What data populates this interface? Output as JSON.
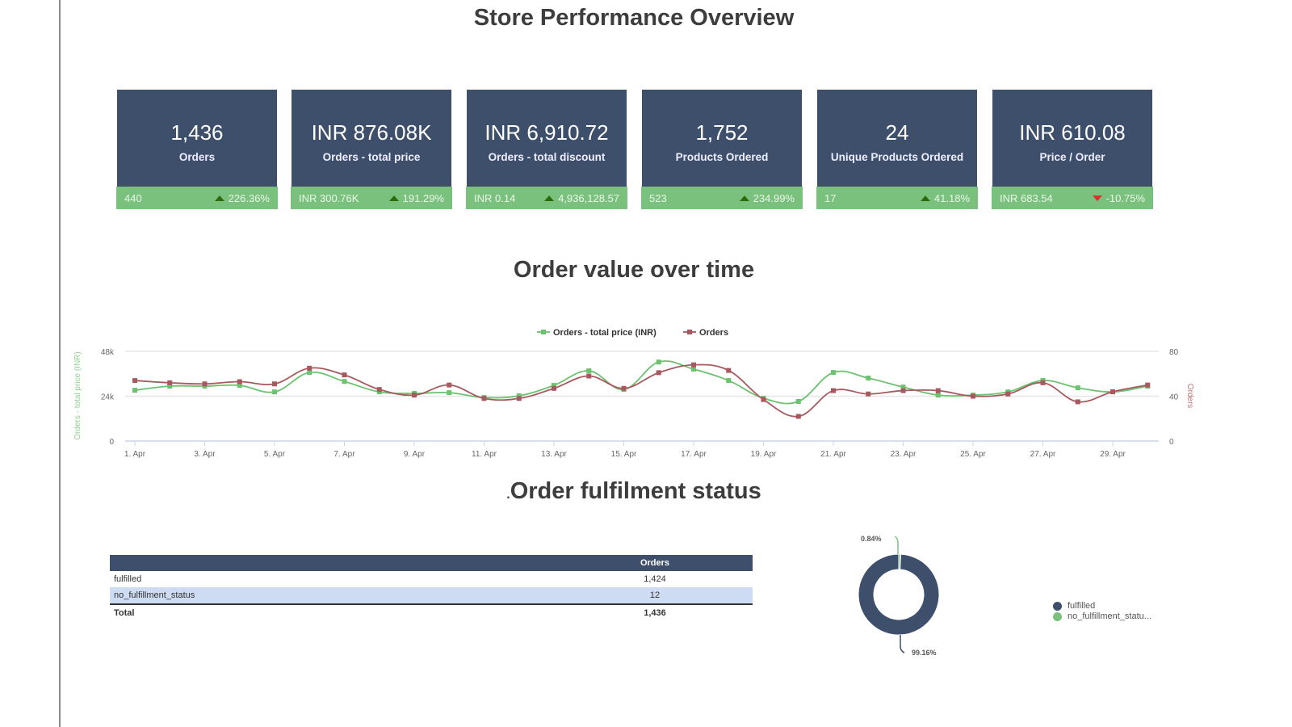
{
  "page": {
    "title": "Store Performance Overview",
    "chart_section_title": "Order value over time",
    "fulfilment_section_title": "Order fulfilment status",
    "fulfilment_title_prefix": "."
  },
  "kpis": [
    {
      "value": "1,436",
      "label": "Orders",
      "previous": "440",
      "change": "226.36%",
      "direction": "up"
    },
    {
      "value": "INR 876.08K",
      "label": "Orders - total price",
      "previous": "INR 300.76K",
      "change": "191.29%",
      "direction": "up"
    },
    {
      "value": "INR 6,910.72",
      "label": "Orders - total discount",
      "previous": "INR 0.14",
      "change": "4,936,128.57",
      "direction": "up"
    },
    {
      "value": "1,752",
      "label": "Products Ordered",
      "previous": "523",
      "change": "234.99%",
      "direction": "up"
    },
    {
      "value": "24",
      "label": "Unique Products Ordered",
      "previous": "17",
      "change": "41.18%",
      "direction": "up"
    },
    {
      "value": "INR 610.08",
      "label": "Price / Order",
      "previous": "INR 683.54",
      "change": "-10.75%",
      "direction": "down"
    }
  ],
  "colors": {
    "kpi_bg": "#3d4f6b",
    "kpi_footer": "#7bc17e",
    "up": "#2d6b0f",
    "down": "#d9302e",
    "series_price": "#6cc26f",
    "series_orders": "#a7595f",
    "fulfilled": "#3d4f6b",
    "no_fulfillment": "#7bc17e"
  },
  "chart_data": [
    {
      "type": "line",
      "title": "Order value over time",
      "x": [
        "1. Apr",
        "2. Apr",
        "3. Apr",
        "4. Apr",
        "5. Apr",
        "6. Apr",
        "7. Apr",
        "8. Apr",
        "9. Apr",
        "10. Apr",
        "11. Apr",
        "12. Apr",
        "13. Apr",
        "14. Apr",
        "15. Apr",
        "16. Apr",
        "17. Apr",
        "18. Apr",
        "19. Apr",
        "20. Apr",
        "21. Apr",
        "22. Apr",
        "23. Apr",
        "24. Apr",
        "25. Apr",
        "26. Apr",
        "27. Apr",
        "28. Apr",
        "29. Apr",
        "30. Apr"
      ],
      "x_tick_labels": [
        "1. Apr",
        "3. Apr",
        "5. Apr",
        "7. Apr",
        "9. Apr",
        "11. Apr",
        "13. Apr",
        "15. Apr",
        "17. Apr",
        "19. Apr",
        "21. Apr",
        "23. Apr",
        "25. Apr",
        "27. Apr",
        "29. Apr"
      ],
      "series": [
        {
          "name": "Orders - total price (INR)",
          "axis": "left",
          "values": [
            27200,
            29400,
            29400,
            29800,
            26300,
            36700,
            31900,
            26300,
            25500,
            25900,
            23300,
            24200,
            29800,
            37600,
            27600,
            42300,
            38500,
            32400,
            22900,
            21200,
            36700,
            33700,
            28900,
            24600,
            24600,
            26300,
            32400,
            28500,
            26300,
            29400
          ]
        },
        {
          "name": "Orders",
          "axis": "right",
          "values": [
            54,
            52,
            51,
            53,
            51,
            65,
            59,
            46,
            41,
            50,
            38,
            38,
            47,
            58,
            47,
            61,
            68,
            63,
            37,
            22,
            45,
            42,
            45,
            45,
            40,
            42,
            52,
            35,
            44,
            50
          ]
        }
      ],
      "left_axis": {
        "label": "Orders - total price (INR)",
        "ticks": [
          "0",
          "24k",
          "48k"
        ],
        "range": [
          0,
          48000
        ]
      },
      "right_axis": {
        "label": "Orders",
        "ticks": [
          "0",
          "40",
          "80"
        ],
        "range": [
          0,
          80
        ]
      },
      "legend": [
        "Orders - total price (INR)",
        "Orders"
      ],
      "legend_position": "top-center",
      "grid": true
    },
    {
      "type": "pie",
      "variant": "donut",
      "labels": [
        "fulfilled",
        "no_fulfillment_status"
      ],
      "legend_labels": [
        "fulfilled",
        "no_fulfillment_statu..."
      ],
      "values": [
        1424,
        12
      ],
      "data_labels": [
        "99.16%",
        "0.84%"
      ],
      "legend_position": "right"
    }
  ],
  "table": {
    "columns": [
      "",
      "Orders"
    ],
    "rows": [
      {
        "status": "fulfilled",
        "orders": "1,424"
      },
      {
        "status": "no_fulfillment_status",
        "orders": "12"
      }
    ],
    "total": {
      "label": "Total",
      "orders": "1,436"
    }
  }
}
